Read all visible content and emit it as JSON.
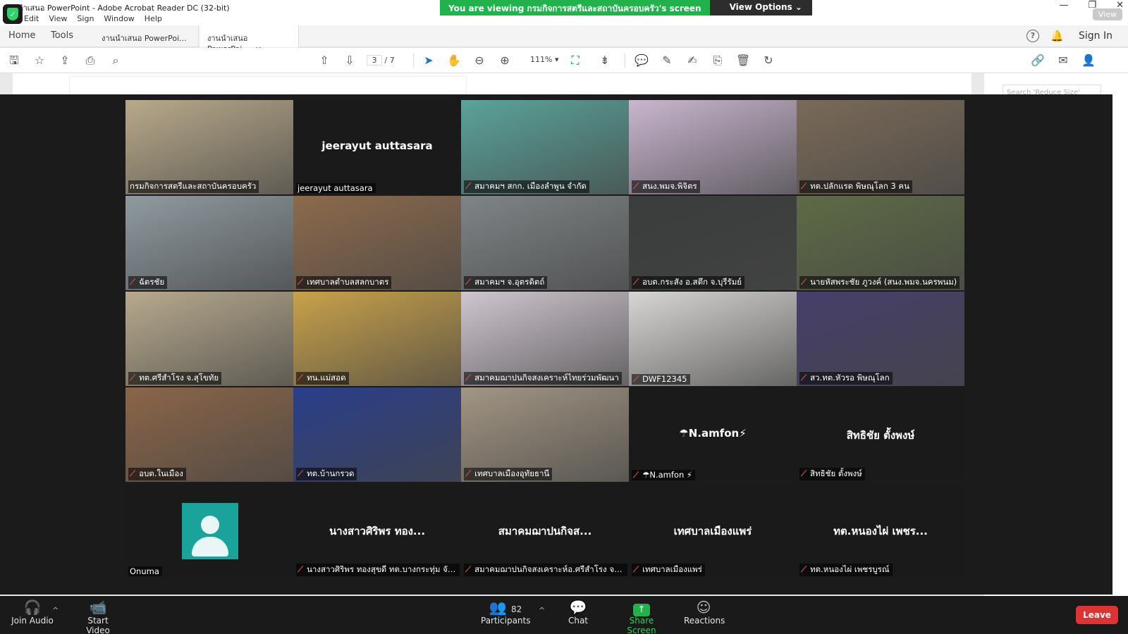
{
  "window": {
    "title": "งานนำเสนอ PowerPoint - Adobe Acrobat Reader DC (32-bit)",
    "menu": [
      "Edit",
      "View",
      "Sign",
      "Window",
      "Help"
    ],
    "view_chip": "View"
  },
  "share_banner": {
    "message": "You are viewing กรมกิจการสตรีและสถาบันครอบครัว's screen",
    "options_label": "View Options ⌄"
  },
  "acrobat": {
    "home": "Home",
    "tools": "Tools",
    "tabs": [
      {
        "label": "งานนำเสนอ PowerPoi..."
      },
      {
        "label": "งานนำเสนอ PowerPoi...",
        "close": "×"
      }
    ],
    "signin": "Sign In",
    "page_current": "3",
    "page_total": "/ 7",
    "zoom": "111%",
    "search_placeholder": "Search 'Reduce Size'"
  },
  "participants_tiles": [
    {
      "label": "กรมกิจการสตรีและสถาบันครอบครัว",
      "muted": false,
      "active": true,
      "color": "#b8a98a"
    },
    {
      "label": "jeerayut auttasara",
      "bigname": "jeerayut auttasara",
      "muted": false,
      "color": "#1a1a1a"
    },
    {
      "label": "สมาคมฯ สกก. เมืองลำพูน จำกัด",
      "muted": true,
      "color": "#5aa39a"
    },
    {
      "label": "สนง.พมจ.พิจิตร",
      "muted": true,
      "color": "#c9b6cf"
    },
    {
      "label": "ทต.ปลักแรด พิษณุโลก 3 คน",
      "muted": true,
      "color": "#7a6a58"
    },
    {
      "label": "ฉัตรชัย",
      "muted": true,
      "color": "#8f9aa0"
    },
    {
      "label": "เทศบาลตำบลสลกบาตร",
      "muted": true,
      "color": "#8d6a4c"
    },
    {
      "label": "สมาคมฯ จ.อุตรดิตถ์",
      "muted": true,
      "color": "#7f8486"
    },
    {
      "label": "อบต.กระสัง อ.สตึก จ.บุรีรัมย์",
      "muted": true,
      "color": "#3a3d3c"
    },
    {
      "label": "นายหัสพระชัย ภูวงค์ (สนง.พมจ.นครพนม)",
      "muted": true,
      "color": "#5e6b45"
    },
    {
      "label": "ทต.ศรีสำโรง จ.สุโขทัย",
      "muted": true,
      "color": "#b7a98d"
    },
    {
      "label": "ทน.แม่สอด",
      "muted": true,
      "color": "#c8a14a"
    },
    {
      "label": "สมาคมฌาปนกิจสงเคราะห์ไทยร่วมพัฒนา",
      "muted": true,
      "color": "#cfc6cf"
    },
    {
      "label": "DWF12345",
      "muted": true,
      "color": "#d8d6d4"
    },
    {
      "label": "สว.ทต.หัวรอ พิษณุโลก",
      "muted": true,
      "color": "#463f6b"
    },
    {
      "label": "อบต.ในเมือง",
      "muted": true,
      "color": "#8b6548"
    },
    {
      "label": "ทต.บ้านกรวด",
      "muted": true,
      "color": "#2a3e8a"
    },
    {
      "label": "เทศบาลเมืองอุทัยธานี",
      "muted": true,
      "color": "#a29583"
    },
    {
      "label": "☂N.amfon ⚡",
      "bigname": "☂N.amfon⚡",
      "muted": true,
      "color": "#1a1a1a"
    },
    {
      "label": "สิทธิชัย ตั้งพงษ์",
      "bigname": "สิทธิชัย ตั้งพงษ์",
      "muted": true,
      "color": "#1a1a1a"
    },
    {
      "label": "Onuma",
      "avatar": true,
      "muted": false,
      "color": "#1a1a1a"
    },
    {
      "label": "นางสาวศิริพร ทองสุขดี ทต.บางกระทุ่ม จัง...",
      "bigname": "นางสาวศิริพร ทอง...",
      "muted": true,
      "color": "#1a1a1a"
    },
    {
      "label": "สมาคมฌาปนกิจสงเคราะห์อ.ศรีสำโรง จ.สุโ...",
      "bigname": "สมาคมฌาปนกิจส...",
      "muted": true,
      "color": "#1a1a1a"
    },
    {
      "label": "เทศบาลเมืองแพร่",
      "bigname": "เทศบาลเมืองแพร่",
      "muted": true,
      "color": "#1a1a1a"
    },
    {
      "label": "ทต.หนองไผ่ เพชรบูรณ์",
      "bigname": "ทต.หนองไผ่ เพชร...",
      "muted": true,
      "color": "#1a1a1a"
    }
  ],
  "zoom_bar": {
    "join_audio": "Join Audio",
    "start_video": "Start Video",
    "participants": "Participants",
    "participants_count": "82",
    "chat": "Chat",
    "share_screen": "Share Screen",
    "reactions": "Reactions",
    "leave": "Leave"
  }
}
